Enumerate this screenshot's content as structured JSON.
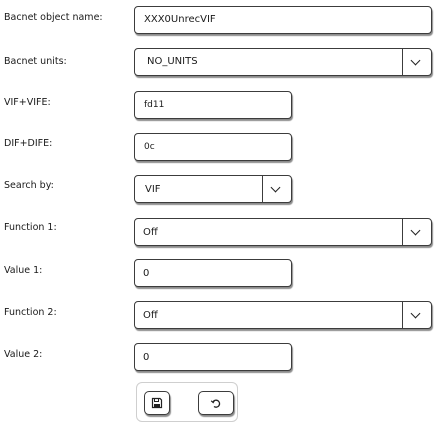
{
  "fields": [
    {
      "label": "Bacnet object name:",
      "value": "XXX0UnrecVIF"
    },
    {
      "label": "Bacnet units:",
      "value": "NO_UNITS"
    },
    {
      "label": "VIF+VIFE:",
      "value": "fd11"
    },
    {
      "label": "DIF+DIFE:",
      "value": "0c"
    },
    {
      "label": "Search by:",
      "value": "VIF"
    },
    {
      "label": "Function 1:",
      "value": "Off"
    },
    {
      "label": "Value 1:",
      "value": "0"
    },
    {
      "label": "Function 2:",
      "value": "Off"
    },
    {
      "label": "Value 2:",
      "value": "0"
    }
  ],
  "dropdown_icon": "chevron-down-icon",
  "buttons": {
    "save_icon": "save-icon",
    "undo_icon": "undo-icon"
  }
}
